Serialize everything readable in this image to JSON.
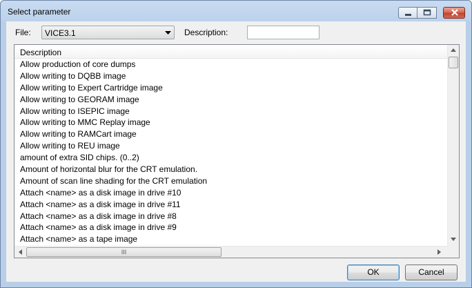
{
  "window": {
    "title": "Select parameter"
  },
  "file": {
    "label": "File:",
    "value": "VICE3.1"
  },
  "description_filter": {
    "label": "Description:",
    "value": ""
  },
  "list": {
    "column_header": "Description",
    "rows": [
      "Allow production of core dumps",
      "Allow writing to DQBB image",
      "Allow writing to Expert Cartridge image",
      "Allow writing to GEORAM image",
      "Allow writing to ISEPIC image",
      "Allow writing to MMC Replay image",
      "Allow writing to RAMCart image",
      "Allow writing to REU image",
      "amount of extra SID chips. (0..2)",
      "Amount of horizontal blur for the CRT emulation.",
      "Amount of scan line shading for the CRT emulation",
      "Attach <name> as a disk image in drive #10",
      "Attach <name> as a disk image in drive #11",
      "Attach <name> as a disk image in drive #8",
      "Attach <name> as a disk image in drive #9",
      "Attach <name> as a tape image"
    ],
    "hscroll_grip": "III"
  },
  "buttons": {
    "ok": "OK",
    "cancel": "Cancel"
  }
}
